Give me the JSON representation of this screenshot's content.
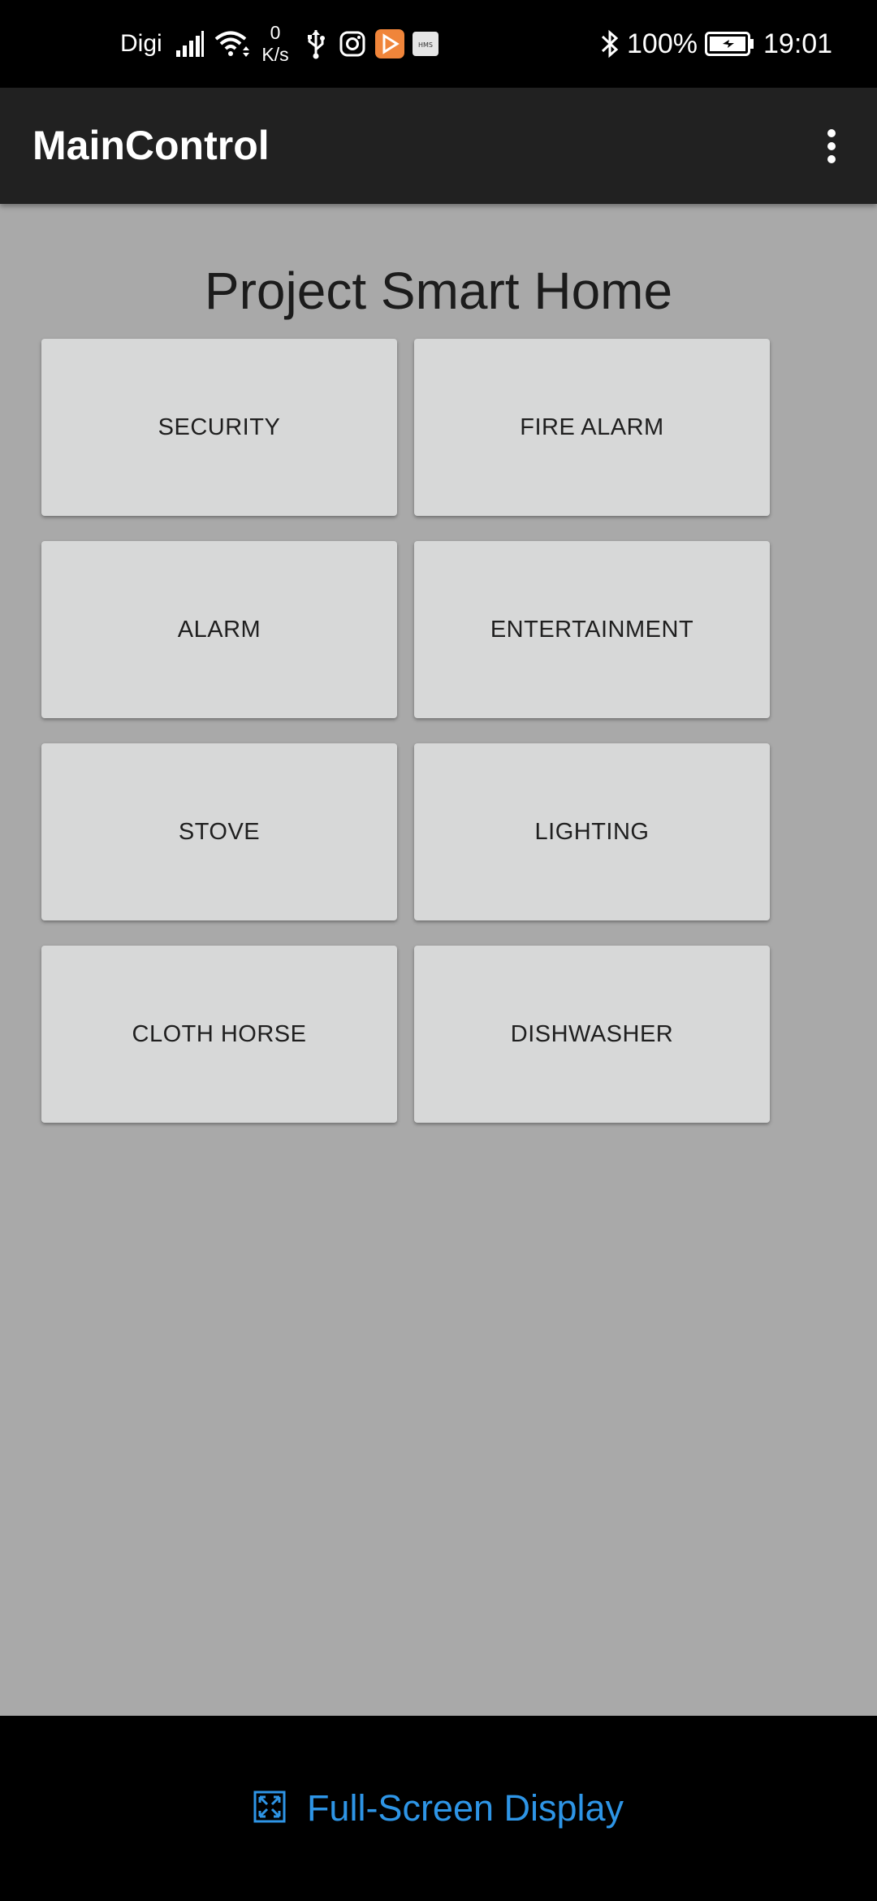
{
  "status_bar": {
    "carrier": "Digi",
    "net_speed_value": "0",
    "net_speed_unit": "K/s",
    "battery_percent": "100%",
    "time": "19:01",
    "icons": [
      "signal-icon",
      "wifi-icon",
      "usb-icon",
      "instagram-icon",
      "app-notification-icon",
      "hms-icon",
      "bluetooth-icon",
      "battery-icon"
    ]
  },
  "app_bar": {
    "title": "MainControl",
    "menu_icon": "more-vert-icon"
  },
  "main": {
    "heading": "Project Smart Home",
    "tiles": [
      {
        "label": "SECURITY"
      },
      {
        "label": "FIRE ALARM"
      },
      {
        "label": "ALARM"
      },
      {
        "label": "ENTERTAINMENT"
      },
      {
        "label": "STOVE"
      },
      {
        "label": "LIGHTING"
      },
      {
        "label": "CLOTH HORSE"
      },
      {
        "label": "DISHWASHER"
      }
    ]
  },
  "bottom_bar": {
    "label": "Full-Screen Display",
    "icon": "fullscreen-icon",
    "accent_color": "#2e95e6"
  },
  "colors": {
    "app_bar": "#212121",
    "content_background": "#a9a9a9",
    "tile_background": "#d7d8d8"
  }
}
